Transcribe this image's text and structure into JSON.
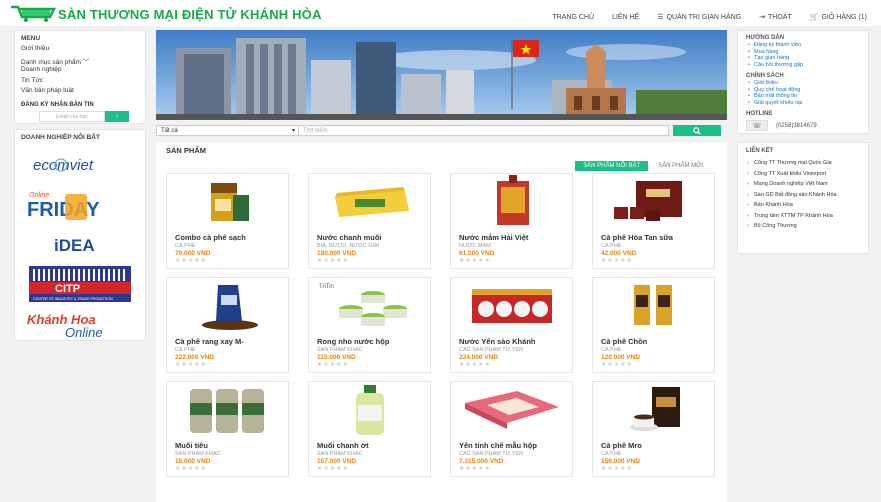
{
  "site": {
    "logo_text": "SÀN THƯƠNG MẠI ĐIỆN TỬ KHÁNH HÒA"
  },
  "nav": {
    "home": "TRANG CHỦ",
    "contact": "LIÊN HỆ",
    "manage": "QUẢN TRỊ GIAN HÀNG",
    "logout": "THOÁT",
    "cart": "GIỎ HÀNG (1)"
  },
  "menu": {
    "title": "MENU",
    "items": [
      "Giới thiệu",
      "Danh mục sản phẩm",
      "Doanh nghiệp",
      "Tin Tức",
      "Văn bản pháp luật"
    ],
    "newsletter_title": "ĐĂNG KÝ NHẬN BẢN TIN",
    "email_placeholder": "Email của bạn",
    "email_btn": "›"
  },
  "partners": {
    "title": "DOANH NGHIỆP NỔI BẬT",
    "logos": [
      "ecomviet",
      "Online FRIDAY",
      "iDEA",
      "CITP",
      "Khánh Hòa Online"
    ],
    "friday_top": "Online",
    "friday_main": "FRIDAY",
    "citp_sub": "CENTER OF INDUSTRY & TRADE PROMOTION",
    "kho_top": "Khánh Hoa",
    "kho_bottom": "Online"
  },
  "search": {
    "category": "Tất cả",
    "placeholder": "Tìm kiếm",
    "button_icon": "search-icon"
  },
  "products": {
    "title": "SẢN PHẨM",
    "tab_featured": "SẢN PHẨM NỔI BẬT",
    "tab_new": "SẢN PHẨM MỚI",
    "items": [
      {
        "name": "Combo cà phê sạch",
        "cat": "CÀ PHÊ",
        "price": "70.000 VND"
      },
      {
        "name": "Nước chanh muối",
        "cat": "BIA, RƯỢU, NƯỚC GIẢI",
        "price": "180.000 VND"
      },
      {
        "name": "Nước mắm Hải Việt",
        "cat": "NƯỚC MẮM",
        "price": "61.000 VND"
      },
      {
        "name": "Cà phê Hòa Tan sữa",
        "cat": "CÀ PHÊ",
        "price": "42.000 VND"
      },
      {
        "name": "Cà phê rang xay M-",
        "cat": "CÀ PHÊ",
        "price": "222.000 VND"
      },
      {
        "name": "Rong nho nước hộp",
        "cat": "SẢN PHẨM KHÁC",
        "price": "115.000 VND"
      },
      {
        "name": "Nước Yến sào Khánh",
        "cat": "CÁC SẢN PHẨM TỪ YẾN",
        "price": "224.000 VND"
      },
      {
        "name": "Cà phê Chồn",
        "cat": "CÀ PHÊ",
        "price": "120.000 VND"
      },
      {
        "name": "Muối tiêu",
        "cat": "SẢN PHẨM KHÁC",
        "price": "15.000 VND"
      },
      {
        "name": "Muối chanh ớt",
        "cat": "SẢN PHẨM KHÁC",
        "price": "157.000 VND"
      },
      {
        "name": "Yến tinh chế mẫu hộp",
        "cat": "CÁC SẢN PHẨM TỪ YẾN",
        "price": "7.315.000 VND"
      },
      {
        "name": "Cà phê Mro",
        "cat": "CÀ PHÊ",
        "price": "156.000 VND"
      }
    ],
    "stars": "★★★★★",
    "rongnho_logo": "TriTin"
  },
  "guide": {
    "title": "HƯỚNG DẪN",
    "items": [
      "Đăng ký thành viên",
      "Mua hàng",
      "Tạo gian hàng",
      "Câu hỏi thường gặp"
    ],
    "policy_title": "CHÍNH SÁCH",
    "policy_items": [
      "Giới thiệu",
      "Quy chế hoạt động",
      "Bảo mật thông tin",
      "Giải quyết khiếu nại"
    ],
    "hotline_title": "HOTLINE",
    "hotline": "(0258)3814679"
  },
  "links": {
    "title": "LIÊN KẾT",
    "items": [
      "Cổng TT Thương mại Quốc Gia",
      "Cổng TT Xuất khẩu Vinexport",
      "Mạng Doanh nghiệp Việt Nam",
      "Sàn GD Bất động sản Khánh Hòa",
      "Báo Khánh Hòa",
      "Trung tâm XTTM TP Khánh Hòa",
      "Bộ Công Thương"
    ]
  },
  "colors": {
    "brand": "#19a94a",
    "accent": "#1bbf8c",
    "price": "#e6850e"
  }
}
